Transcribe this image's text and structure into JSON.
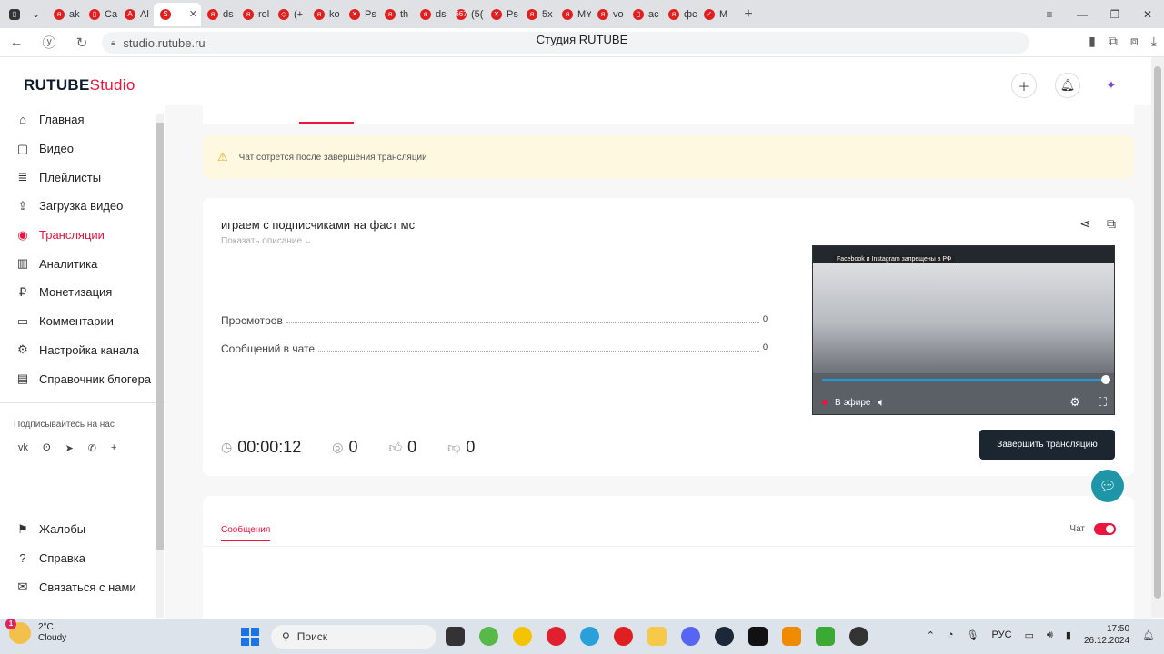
{
  "browser": {
    "tabs": [
      {
        "label": "ak",
        "fav": "я"
      },
      {
        "label": "Ca",
        "fav": "▯"
      },
      {
        "label": "Al",
        "fav": "A"
      },
      {
        "label": "",
        "fav": "S",
        "active": true
      },
      {
        "label": "ds",
        "fav": "я"
      },
      {
        "label": "rol",
        "fav": "я"
      },
      {
        "label": "(+",
        "fav": "◇"
      },
      {
        "label": "ko",
        "fav": "я"
      },
      {
        "label": "Ps",
        "fav": "✕"
      },
      {
        "label": "th",
        "fav": "я"
      },
      {
        "label": "ds",
        "fav": "я"
      },
      {
        "label": "(5(",
        "fav": "667"
      },
      {
        "label": "Ps",
        "fav": "✕"
      },
      {
        "label": "5x",
        "fav": "я"
      },
      {
        "label": "MY",
        "fav": "я"
      },
      {
        "label": "vo",
        "fav": "я"
      },
      {
        "label": "ac",
        "fav": "▯"
      },
      {
        "label": "фс",
        "fav": "я"
      },
      {
        "label": "M",
        "fav": "✓"
      }
    ],
    "url": "studio.rutube.ru",
    "page_title": "Студия RUTUBE",
    "colors": {
      "accent": "#ed143d",
      "dark_button": "#1c2630",
      "help_fab": "#1e96a8"
    }
  },
  "header": {
    "logo_main": "RUTUBE",
    "logo_studio": "Studio",
    "icons": [
      "add-video-icon",
      "bell-icon",
      "avatar-icon"
    ]
  },
  "sidebar": {
    "items": [
      {
        "label": "Главная",
        "icon": "⌂"
      },
      {
        "label": "Видео",
        "icon": "▢"
      },
      {
        "label": "Плейлисты",
        "icon": "≣"
      },
      {
        "label": "Загрузка видео",
        "icon": "⇪"
      },
      {
        "label": "Трансляции",
        "icon": "◉",
        "active": true
      },
      {
        "label": "Аналитика",
        "icon": "▥"
      },
      {
        "label": "Монетизация",
        "icon": "₽"
      },
      {
        "label": "Комментарии",
        "icon": "▭"
      },
      {
        "label": "Настройка канала",
        "icon": "⚙"
      },
      {
        "label": "Справочник блогера",
        "icon": "▤"
      }
    ],
    "subscribe_title": "Подписывайтесь на нас",
    "socials": [
      "vk",
      "ok",
      "tg",
      "viber",
      "+"
    ],
    "bottom_items": [
      {
        "label": "Жалобы",
        "icon": "⚑"
      },
      {
        "label": "Справка",
        "icon": "?"
      },
      {
        "label": "Связаться с нами",
        "icon": "✉"
      }
    ]
  },
  "alert": {
    "text": "Чат сотрётся после завершения трансляции"
  },
  "stream": {
    "title": "играем с подписчиками на фаст мс",
    "show_description": "Показать описание",
    "stats": [
      {
        "label": "Просмотров",
        "value": "0"
      },
      {
        "label": "Сообщений в чате",
        "value": "0"
      }
    ],
    "duration": "00:00:12",
    "viewers": "0",
    "likes": "0",
    "dislikes": "0",
    "end_button": "Завершить трансляцию",
    "player": {
      "live_label": "В эфире",
      "notice": "Facebook и Instagram запрещены в РФ",
      "progress": 1.0
    }
  },
  "chat": {
    "tab": "Сообщения",
    "toggle_label": "Чат",
    "enabled": true
  },
  "taskbar": {
    "weather_temp": "2°C",
    "weather_desc": "Cloudy",
    "badge": "1",
    "search_placeholder": "Поиск",
    "lang": "РУС",
    "time": "17:50",
    "date": "26.12.2024"
  }
}
